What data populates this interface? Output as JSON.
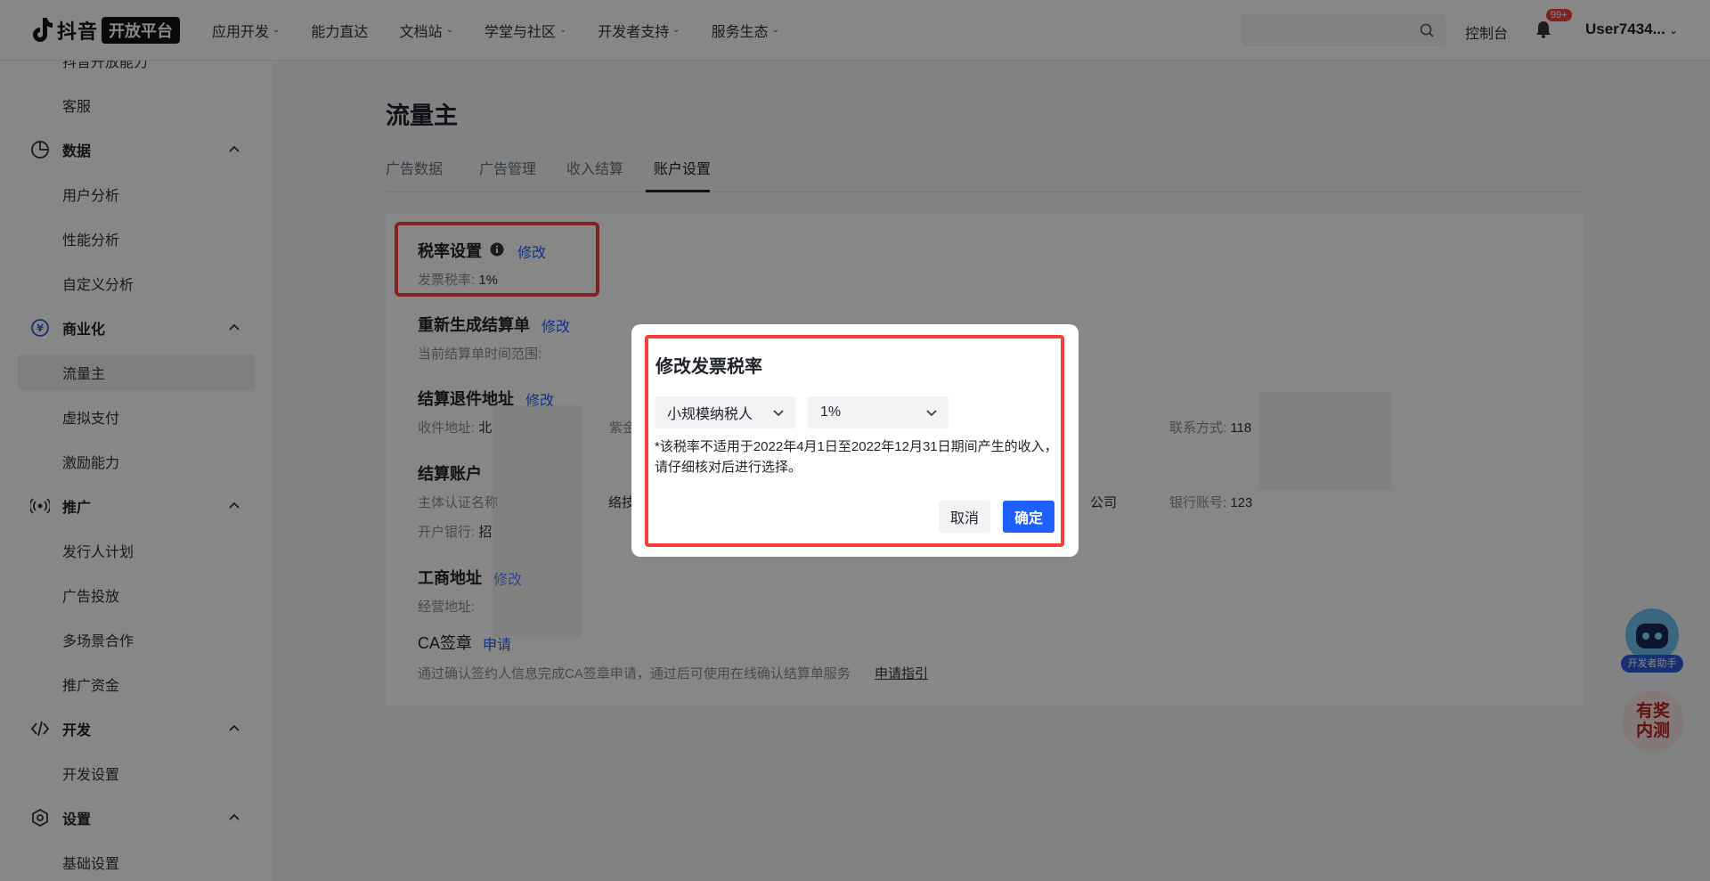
{
  "topbar": {
    "logo_text": "抖音",
    "logo_pill": "开放平台",
    "nav": [
      "应用开发",
      "能力直达",
      "文档站",
      "学堂与社区",
      "开发者支持",
      "服务生态"
    ],
    "nav_has_caret": [
      true,
      false,
      true,
      true,
      true,
      true
    ],
    "console": "控制台",
    "badge": "99+",
    "user": "User7434..."
  },
  "sidebar": {
    "items": [
      {
        "type": "sub",
        "label": "抖音开放能力"
      },
      {
        "type": "sub",
        "label": "客服"
      },
      {
        "type": "group",
        "label": "数据",
        "icon": "pie-chart-icon"
      },
      {
        "type": "sub",
        "label": "用户分析"
      },
      {
        "type": "sub",
        "label": "性能分析"
      },
      {
        "type": "sub",
        "label": "自定义分析"
      },
      {
        "type": "group",
        "label": "商业化",
        "icon": "yen-icon"
      },
      {
        "type": "sub",
        "label": "流量主",
        "active": true
      },
      {
        "type": "sub",
        "label": "虚拟支付"
      },
      {
        "type": "sub",
        "label": "激励能力"
      },
      {
        "type": "group",
        "label": "推广",
        "icon": "broadcast-icon"
      },
      {
        "type": "sub",
        "label": "发行人计划"
      },
      {
        "type": "sub",
        "label": "广告投放"
      },
      {
        "type": "sub",
        "label": "多场景合作"
      },
      {
        "type": "sub",
        "label": "推广资金"
      },
      {
        "type": "group",
        "label": "开发",
        "icon": "code-icon"
      },
      {
        "type": "sub",
        "label": "开发设置"
      },
      {
        "type": "group",
        "label": "设置",
        "icon": "settings-icon"
      },
      {
        "type": "sub",
        "label": "基础设置"
      }
    ]
  },
  "main": {
    "title": "流量主",
    "tabs": [
      "广告数据",
      "广告管理",
      "收入结算",
      "账户设置"
    ],
    "active_tab": "账户设置",
    "sections": {
      "tax": {
        "title": "税率设置",
        "link": "修改",
        "label": "发票税率:",
        "value": "1%"
      },
      "regen": {
        "title": "重新生成结算单",
        "link": "修改",
        "label": "当前结算单时间范围:"
      },
      "return_addr": {
        "title": "结算退件地址",
        "link": "修改",
        "label": "收件地址:",
        "value_prefix": "北",
        "value_mid": "紫金",
        "contact_label": "联系方式:",
        "contact_value": "118"
      },
      "account": {
        "title": "结算账户",
        "subject_label": "主体认证名称",
        "subject_mid": "络技",
        "subject_end": "公司",
        "bank_no_label": "银行账号:",
        "bank_no_value": "123",
        "bank_label": "开户银行:",
        "bank_value": "招"
      },
      "business_addr": {
        "title": "工商地址",
        "link": "修改",
        "label": "经营地址:"
      },
      "ca": {
        "title": "CA签章",
        "link": "申请",
        "desc": "通过确认签约人信息完成CA签章申请，通过后可使用在线确认结算单服务",
        "guide": "申请指引"
      }
    }
  },
  "modal": {
    "title": "修改发票税率",
    "taxpayer_type": "小规模纳税人",
    "rate": "1%",
    "note": "*该税率不适用于2022年4月1日至2022年12月31日期间产生的收入，请仔细核对后进行选择。",
    "cancel": "取消",
    "confirm": "确定"
  },
  "floating": {
    "assistant": "开发者助手",
    "prize_line1": "有奖",
    "prize_line2": "内测"
  },
  "colors": {
    "accent": "#1e5fff",
    "highlight_red": "#f53f3f",
    "overlay": "rgba(0,0,0,0.47)"
  }
}
